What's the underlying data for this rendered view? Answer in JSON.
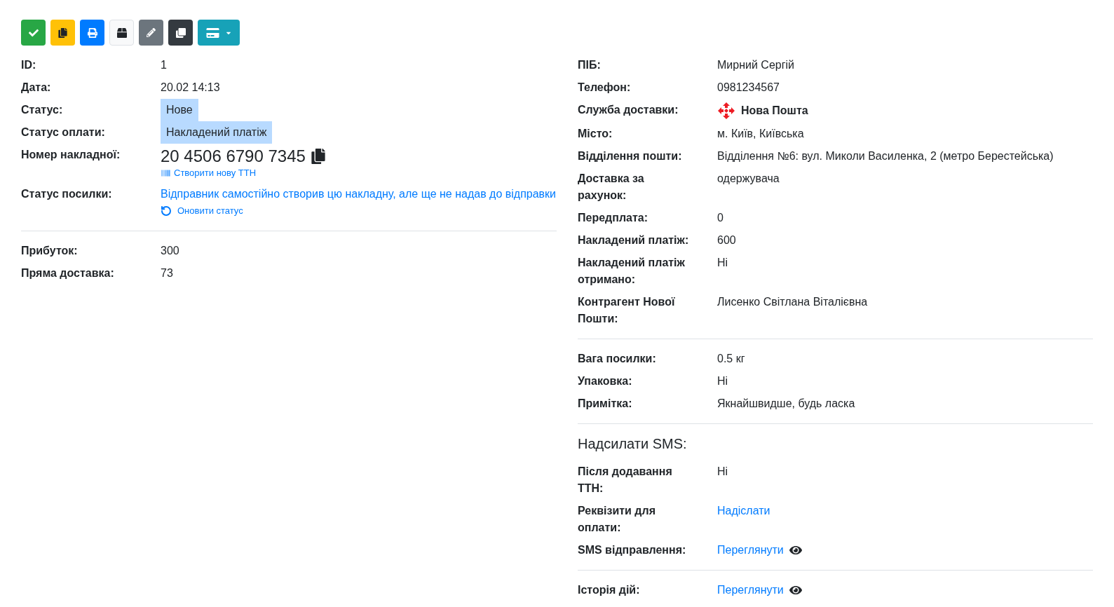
{
  "toolbar": [
    {
      "kind": "confirm"
    },
    {
      "kind": "copy"
    },
    {
      "kind": "print"
    },
    {
      "kind": "package"
    },
    {
      "kind": "edit"
    },
    {
      "kind": "duplicate"
    },
    {
      "kind": "payment"
    }
  ],
  "left": [
    {
      "rows": [
        {
          "label": "ID:",
          "kind": "text",
          "value": "1"
        },
        {
          "label": "Дата:",
          "kind": "text",
          "value": "20.02 14:13"
        },
        {
          "label": "Статус:",
          "kind": "tag",
          "value": "Нове"
        },
        {
          "label": "Статус оплати:",
          "kind": "tag",
          "value": "Накладений платіж"
        },
        {
          "label": "Номер накладної:",
          "kind": "tracking",
          "value": "20 4506 6790 7345",
          "action": "Створити нову ТТН"
        },
        {
          "label": "Статус посилки:",
          "kind": "status",
          "value": "Відправник самостійно створив цю накладну, але ще не надав до відправки",
          "action": "Оновити статус"
        }
      ]
    },
    {
      "rows": [
        {
          "label": "Прибуток:",
          "kind": "text",
          "value": "300"
        },
        {
          "label": "Пряма доставка:",
          "kind": "text",
          "value": "73"
        }
      ]
    }
  ],
  "right": [
    {
      "rows": [
        {
          "label": "ПІБ:",
          "kind": "text",
          "value": "Мирний Сергій"
        },
        {
          "label": "Телефон:",
          "kind": "text",
          "value": "0981234567"
        },
        {
          "label": "Служба доставки:",
          "kind": "carrier",
          "value": "Нова Пошта"
        },
        {
          "label": "Місто:",
          "kind": "text",
          "value": "м. Київ, Київська"
        },
        {
          "label": "Відділення пошти:",
          "kind": "text",
          "value": "Відділення №6: вул. Миколи Василенка, 2 (метро Берестейська)"
        },
        {
          "label": "Доставка за рахунок:",
          "kind": "text",
          "value": "одержувача"
        },
        {
          "label": "Передплата:",
          "kind": "text",
          "value": "0"
        },
        {
          "label": "Накладений платіж:",
          "kind": "text",
          "value": "600"
        },
        {
          "label": "Накладений платіж отримано:",
          "kind": "text",
          "value": "Ні"
        },
        {
          "label": "Контрагент Нової Пошти:",
          "kind": "text",
          "value": "Лисенко Світлана Віталієвна"
        }
      ]
    },
    {
      "rows": [
        {
          "label": "Вага посилки:",
          "kind": "text",
          "value": "0.5 кг"
        },
        {
          "label": "Упаковка:",
          "kind": "text",
          "value": "Ні"
        },
        {
          "label": "Примітка:",
          "kind": "text",
          "value": "Якнайшвидше, будь ласка"
        }
      ]
    },
    {
      "heading": "Надсилати SMS:",
      "rows": [
        {
          "label": "Після додавання ТТН:",
          "kind": "text",
          "value": "Ні"
        },
        {
          "label": "Реквізити для оплати:",
          "kind": "link",
          "value": "Надіслати"
        },
        {
          "label": "SMS відправлення:",
          "kind": "view",
          "value": "Переглянути"
        }
      ]
    },
    {
      "rows": [
        {
          "label": "Історія дій:",
          "kind": "view",
          "value": "Переглянути"
        }
      ]
    }
  ]
}
